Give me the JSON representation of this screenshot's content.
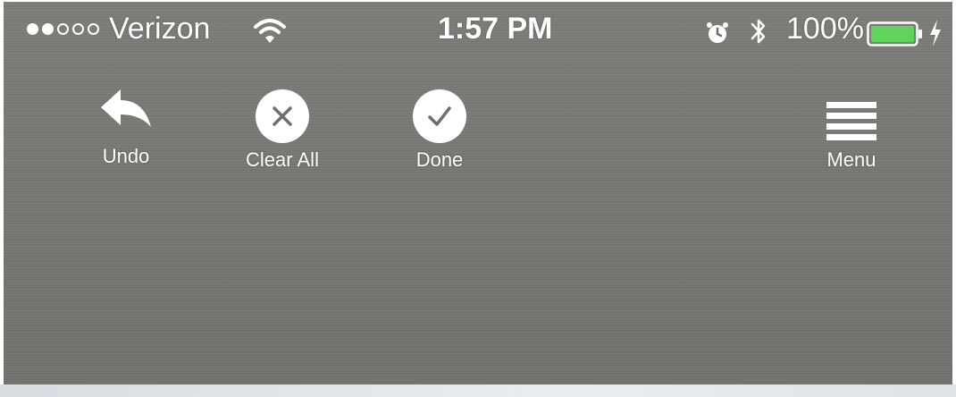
{
  "status_bar": {
    "signal_dots": {
      "filled": 2,
      "total": 5
    },
    "carrier": "Verizon",
    "time": "1:57 PM",
    "battery_percent": "100%",
    "icons": [
      "wifi-icon",
      "alarm-icon",
      "bluetooth-icon",
      "battery-icon",
      "charging-icon"
    ],
    "battery_color": "#5fd35a"
  },
  "toolbar": {
    "undo_label": "Undo",
    "clear_all_label": "Clear All",
    "done_label": "Done",
    "menu_label": "Menu",
    "icons": [
      "undo-icon",
      "clear-all-icon",
      "done-icon",
      "menu-icon"
    ]
  },
  "colors": {
    "background": "#777773",
    "foreground": "#ffffff"
  }
}
